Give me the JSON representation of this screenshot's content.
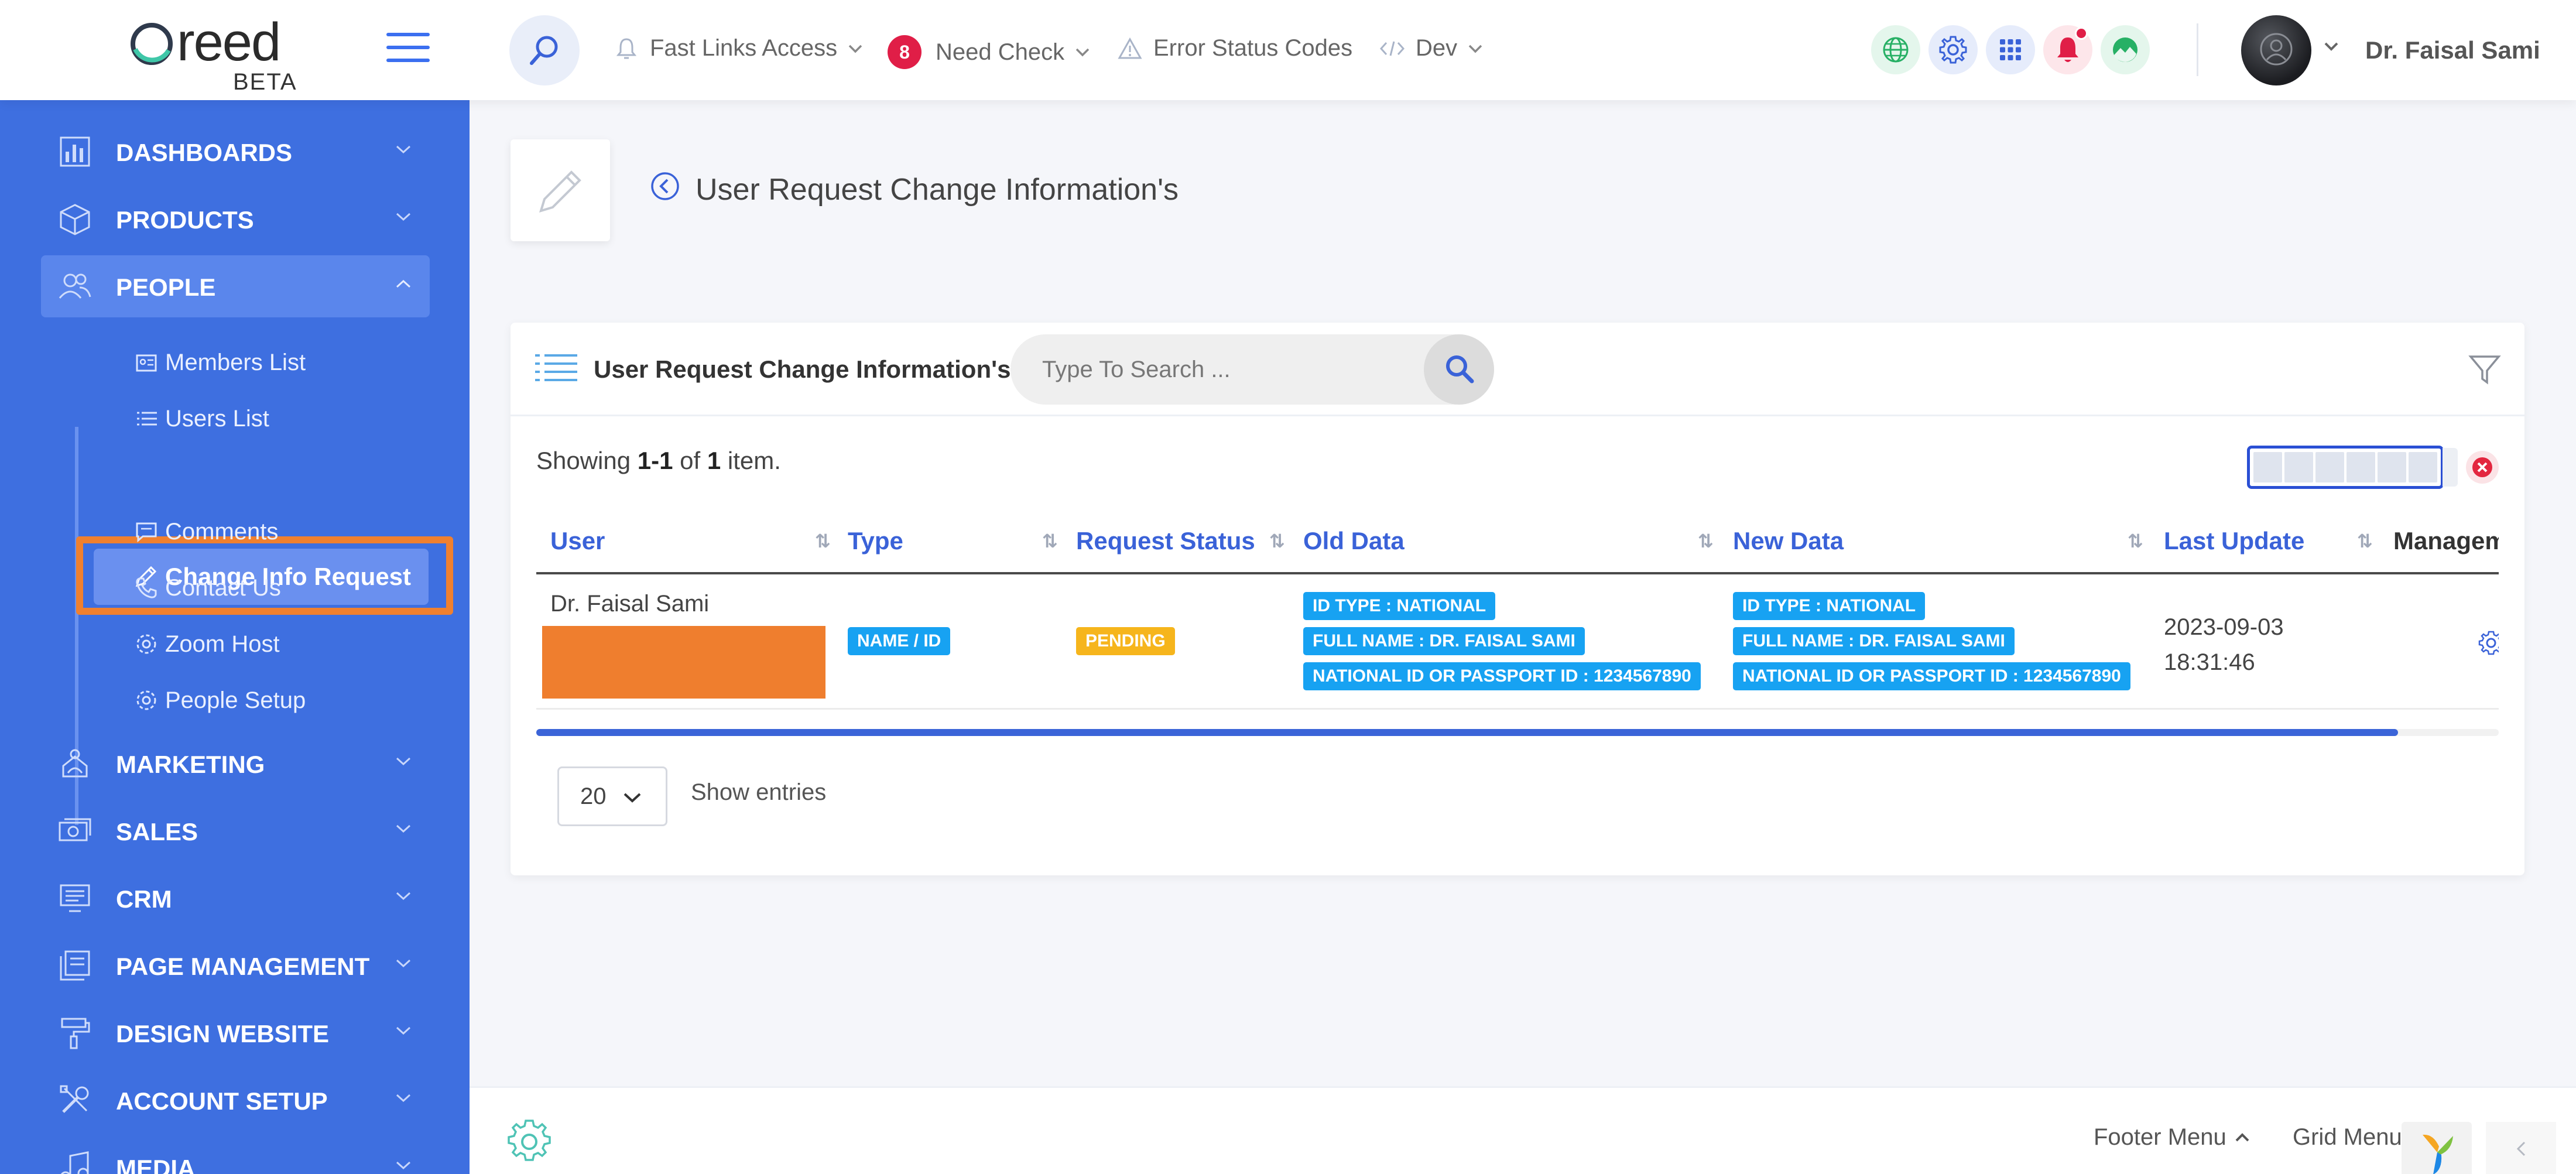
{
  "brand": {
    "logo_text": "reed",
    "beta_label": "BETA"
  },
  "header": {
    "fast_links": "Fast Links Access",
    "need_check_count": "8",
    "need_check": "Need Check",
    "error_codes": "Error Status Codes",
    "dev": "Dev",
    "user_name": "Dr. Faisal Sami"
  },
  "sidebar": {
    "items": [
      {
        "label": "DASHBOARDS",
        "icon": "bar-chart-icon"
      },
      {
        "label": "PRODUCTS",
        "icon": "box-icon"
      },
      {
        "label": "PEOPLE",
        "icon": "people-icon"
      },
      {
        "label": "MARKETING",
        "icon": "megaphone-icon"
      },
      {
        "label": "SALES",
        "icon": "cash-icon"
      },
      {
        "label": "CRM",
        "icon": "monitor-icon"
      },
      {
        "label": "PAGE MANAGEMENT",
        "icon": "pages-icon"
      },
      {
        "label": "DESIGN WEBSITE",
        "icon": "paint-roller-icon"
      },
      {
        "label": "ACCOUNT SETUP",
        "icon": "tools-icon"
      },
      {
        "label": "MEDIA",
        "icon": "music-icon"
      }
    ],
    "people_sub": [
      {
        "label": "Members List",
        "icon": "id-card-icon"
      },
      {
        "label": "Users List",
        "icon": "list-icon"
      },
      {
        "label": "Change Info Request",
        "icon": "pencil-icon"
      },
      {
        "label": "Comments",
        "icon": "comment-icon"
      },
      {
        "label": "Contact Us",
        "icon": "phone-icon"
      },
      {
        "label": "Zoom Host",
        "icon": "gear-icon"
      },
      {
        "label": "People Setup",
        "icon": "gear-icon"
      }
    ]
  },
  "page": {
    "title": "User Request Change Information's"
  },
  "card": {
    "title": "User Request Change Information's",
    "search_placeholder": "Type To Search ...",
    "showing_prefix": "Showing ",
    "showing_range": "1-1",
    "showing_of": " of ",
    "showing_total": "1",
    "showing_suffix": " item."
  },
  "table": {
    "columns": [
      "User",
      "Type",
      "Request Status",
      "Old Data",
      "New Data",
      "Last Update",
      "Management"
    ],
    "rows": [
      {
        "user": "Dr. Faisal Sami",
        "type": "NAME / ID",
        "status": "PENDING",
        "old_data": [
          "ID TYPE : NATIONAL",
          "FULL NAME : DR. FAISAL SAMI",
          "NATIONAL ID OR PASSPORT ID : 1234567890"
        ],
        "new_data": [
          "ID TYPE : NATIONAL",
          "FULL NAME : DR. FAISAL SAMI",
          "NATIONAL ID OR PASSPORT ID : 1234567890"
        ],
        "last_update_date": "2023-09-03",
        "last_update_time": "18:31:46"
      }
    ]
  },
  "pagination": {
    "page_size": "20",
    "show_entries": "Show entries"
  },
  "footer": {
    "footer_menu": "Footer Menu",
    "grid_menu": "Grid Menu"
  },
  "colors": {
    "sidebar": "#3e6fe0",
    "accent": "#3a62d8",
    "tag_info": "#17a2f2",
    "tag_warning": "#f6b51c",
    "highlight": "#f0802f"
  }
}
